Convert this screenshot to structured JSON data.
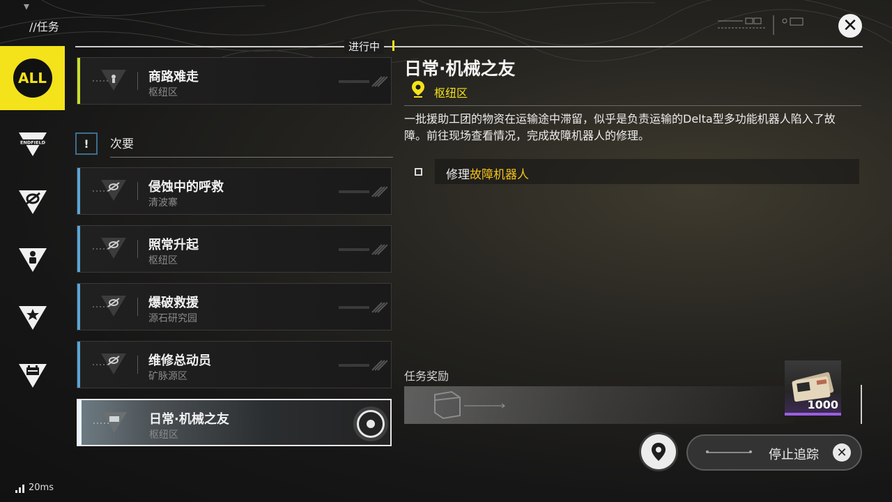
{
  "header": {
    "title": "//任务",
    "tab_label": "进行中"
  },
  "sidebar": {
    "items": [
      {
        "label": "ALL",
        "icon": "all-icon",
        "active": true
      },
      {
        "label": "ENDFIELD",
        "icon": "endfield-icon",
        "active": false
      },
      {
        "label": "",
        "icon": "ring-triangle-icon",
        "active": false
      },
      {
        "label": "",
        "icon": "person-triangle-icon",
        "active": false
      },
      {
        "label": "",
        "icon": "star-triangle-icon",
        "active": false
      },
      {
        "label": "",
        "icon": "calendar-triangle-icon",
        "active": false
      }
    ]
  },
  "quest_list": {
    "main_quest": {
      "name": "商路难走",
      "location": "枢纽区"
    },
    "section": {
      "marker": "!",
      "title": "次要"
    },
    "side_quests": [
      {
        "name": "侵蚀中的呼救",
        "location": "清波寨"
      },
      {
        "name": "照常升起",
        "location": "枢纽区"
      },
      {
        "name": "爆破救援",
        "location": "源石研究园"
      },
      {
        "name": "维修总动员",
        "location": "矿脉源区"
      }
    ],
    "selected_quest": {
      "name": "日常·机械之友",
      "location": "枢纽区"
    }
  },
  "detail": {
    "title": "日常·机械之友",
    "location": "枢纽区",
    "description": "一批援助工团的物资在运输途中滞留，似乎是负责运输的Delta型多功能机器人陷入了故障。前往现场查看情况，完成故障机器人的修理。",
    "objective": {
      "prefix": "修理",
      "highlight": "故障机器人"
    },
    "reward_label": "任务奖励",
    "reward_count": "1000",
    "stop_tracking_label": "停止追踪"
  },
  "status": {
    "ping": "20ms"
  },
  "colors": {
    "accent_yellow": "#f4e21b",
    "side_quest_bar": "#5aa5d8",
    "main_quest_bar": "#c9df2b",
    "rarity_purple": "#9b5fe0"
  }
}
